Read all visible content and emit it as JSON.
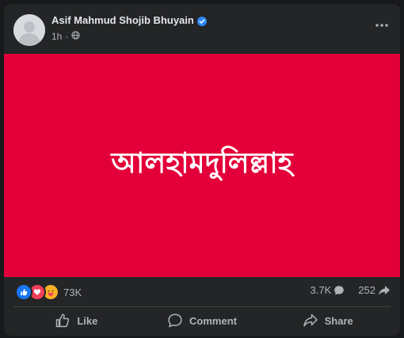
{
  "post": {
    "author": "Asif Mahmud Shojib Bhuyain",
    "time": "1h",
    "verified": true,
    "image_text": "আলহামদুলিল্লাহ",
    "image_color": "#e3003a",
    "reactions": {
      "types": [
        "like",
        "love",
        "care"
      ],
      "count": "73K"
    },
    "comments_count": "3.7K",
    "shares_count": "252",
    "actions": {
      "like_label": "Like",
      "comment_label": "Comment",
      "share_label": "Share"
    },
    "icons": {
      "avatar": "default-avatar-icon",
      "verified": "verified-badge-icon",
      "audience": "globe-icon",
      "more": "more-options-icon",
      "comment_stat": "comment-bubble-icon",
      "share_stat": "share-arrow-icon"
    },
    "colors": {
      "accent": "#2d88ff",
      "like": "#1877f2",
      "love": "#f33e58",
      "care": "#f7b125"
    }
  }
}
